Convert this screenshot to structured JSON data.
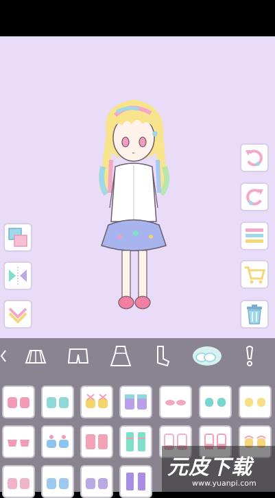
{
  "app": {
    "status_bar": "",
    "colors": {
      "stage_bg": "#e8dcf8",
      "panel_bg": "#8a8491",
      "accent": "#9fd8e6"
    }
  },
  "side_buttons_left": [
    {
      "name": "layer-order-icon"
    },
    {
      "name": "flip-icon"
    },
    {
      "name": "collapse-icon"
    }
  ],
  "side_buttons_right": [
    {
      "name": "undo-icon"
    },
    {
      "name": "redo-icon"
    },
    {
      "name": "menu-icon"
    },
    {
      "name": "shop-cart-icon"
    },
    {
      "name": "trash-icon"
    }
  ],
  "categories": [
    {
      "name": "skirt-category-icon"
    },
    {
      "name": "pants-category-icon"
    },
    {
      "name": "dress-category-icon"
    },
    {
      "name": "socks-category-icon"
    },
    {
      "name": "shoes-category-icon",
      "active": true
    },
    {
      "name": "accessory-category-icon"
    }
  ],
  "items": [
    {
      "color": "#f39bb5"
    },
    {
      "color": "#8fd8d8"
    },
    {
      "color": "#f4d56a"
    },
    {
      "color": "#b9a0e8"
    },
    {
      "color": "#f3a7c0"
    },
    {
      "color": "#79d6cf"
    },
    {
      "color": "#f6df85"
    },
    {
      "color": "#f29bb4"
    },
    {
      "color": "#8cc4ef"
    },
    {
      "color": "#f4a2b6"
    },
    {
      "color": "#7fe0c9"
    },
    {
      "color": "#f2b2c7"
    },
    {
      "color": "#f4a2b6"
    },
    {
      "color": "#f6d67a"
    },
    {
      "color": "#f0b3c7"
    },
    {
      "color": "#9ec9ef"
    },
    {
      "color": "#b9a7e6"
    },
    {
      "color": "#a98fe3"
    }
  ],
  "watermark": {
    "logo": "元皮下载",
    "url": "www.yuanpi.com"
  }
}
